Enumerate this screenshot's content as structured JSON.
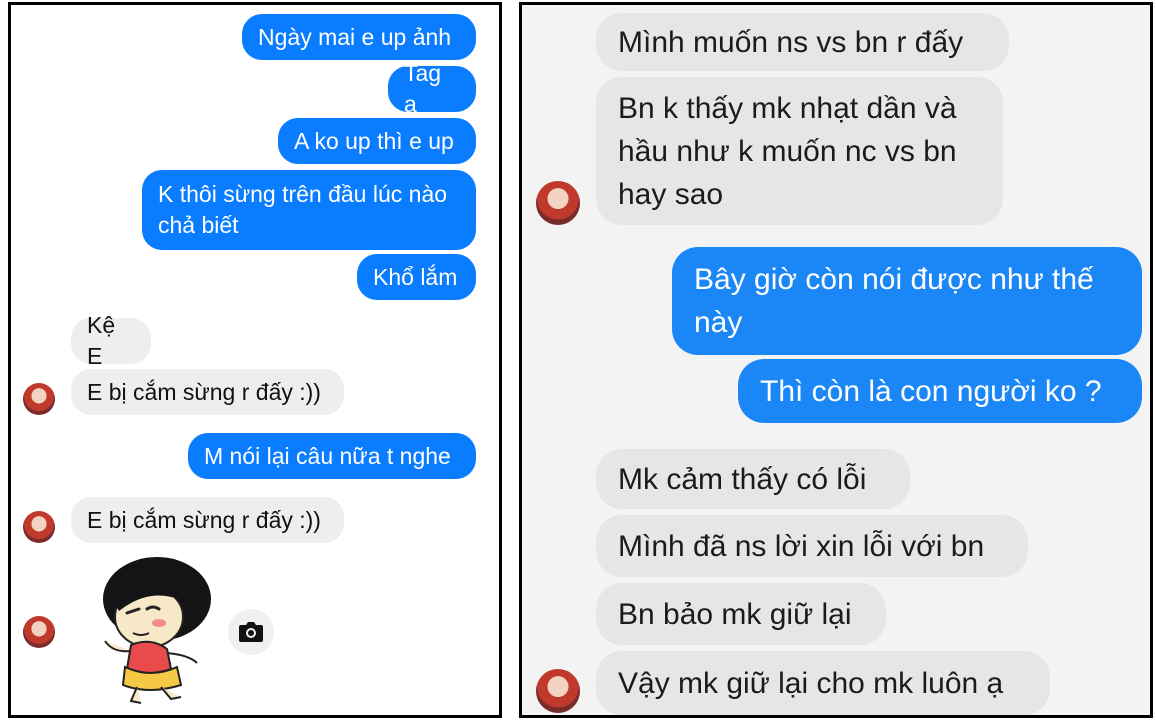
{
  "left_chat": {
    "messages": [
      {
        "text": "Ngày mai e up ảnh"
      },
      {
        "text": "Tag a"
      },
      {
        "text": "A ko up thì e up"
      },
      {
        "text": "K thôi sừng trên đầu lúc nào\nchả biết"
      },
      {
        "text": "Khổ lắm"
      },
      {
        "text": "Kệ E"
      },
      {
        "text": "E bị cắm sừng r đấy :))"
      },
      {
        "text": "M nói lại câu nữa t nghe"
      },
      {
        "text": "E bị cắm sừng r đấy :))"
      }
    ],
    "icons": {
      "avatar": "contact-avatar",
      "camera": "camera-icon",
      "sticker": "cartoon-girl-sticker"
    }
  },
  "right_chat": {
    "messages": [
      {
        "text": "Mình muốn ns vs bn r đấy"
      },
      {
        "text": "Bn k thấy mk nhạt dần và\nhầu như k muốn nc vs bn\nhay sao"
      },
      {
        "text": "Bây giờ còn nói được như thế\nnày"
      },
      {
        "text": "Thì còn là con người ko ?"
      },
      {
        "text": "Mk cảm thấy có lỗi"
      },
      {
        "text": "Mình đã ns lời xin lỗi với bn"
      },
      {
        "text": "Bn bảo mk giữ lại"
      },
      {
        "text": "Vậy mk giữ lại cho mk luôn ạ"
      }
    ]
  },
  "colors": {
    "outgoing_left": "#0a7cff",
    "outgoing_right": "#1b86f5",
    "incoming_left": "#eeeef0",
    "incoming_right": "#e6e6e8",
    "border": "#000000"
  }
}
